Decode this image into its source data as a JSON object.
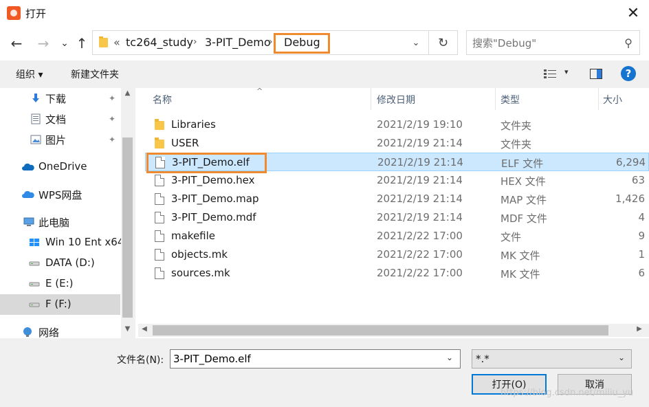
{
  "window": {
    "title": "打开",
    "close_glyph": "✕"
  },
  "nav": {
    "back_glyph": "←",
    "forward_glyph": "→",
    "recent_glyph": "⌄",
    "up_glyph": "↑",
    "breadcrumb_prefix": "«",
    "breadcrumbs": [
      "tc264_study",
      "3-PIT_Demo",
      "Debug"
    ],
    "refresh_glyph": "↻",
    "dropdown_glyph": "⌄"
  },
  "search": {
    "placeholder": "搜索\"Debug\"",
    "icon_glyph": "⚲"
  },
  "toolbar": {
    "organize_label": "组织 ▾",
    "new_folder_label": "新建文件夹",
    "view_dropdown_glyph": "▾",
    "help_glyph": "?"
  },
  "sidebar": {
    "items": [
      {
        "label": "下载",
        "icon": "download-icon",
        "pinned": true
      },
      {
        "label": "文档",
        "icon": "document-icon",
        "pinned": true
      },
      {
        "label": "图片",
        "icon": "picture-icon",
        "pinned": true
      },
      {
        "label": "OneDrive",
        "icon": "cloud-icon",
        "pinned": false
      },
      {
        "label": "WPS网盘",
        "icon": "wps-cloud-icon",
        "pinned": false
      },
      {
        "label": "此电脑",
        "icon": "computer-icon",
        "pinned": false
      },
      {
        "label": "Win 10 Ent x64",
        "icon": "windows-drive-icon",
        "pinned": false
      },
      {
        "label": "DATA (D:)",
        "icon": "drive-icon",
        "pinned": false
      },
      {
        "label": "E (E:)",
        "icon": "drive-icon",
        "pinned": false
      },
      {
        "label": "F (F:)",
        "icon": "drive-icon",
        "pinned": false,
        "selected": true
      },
      {
        "label": "网络",
        "icon": "network-icon",
        "pinned": false
      }
    ],
    "pin_glyph": "📌",
    "scroll_up_glyph": "▲",
    "scroll_down_glyph": "▼"
  },
  "file_list": {
    "columns": {
      "name": "名称",
      "date": "修改日期",
      "type": "类型",
      "size": "大小"
    },
    "sort_glyph": "^",
    "rows": [
      {
        "name": "Libraries",
        "date": "2021/2/19 19:10",
        "type": "文件夹",
        "size": "",
        "kind": "folder"
      },
      {
        "name": "USER",
        "date": "2021/2/19 21:14",
        "type": "文件夹",
        "size": "",
        "kind": "folder"
      },
      {
        "name": "3-PIT_Demo.elf",
        "date": "2021/2/19 21:14",
        "type": "ELF 文件",
        "size": "6,294",
        "kind": "file",
        "selected": true
      },
      {
        "name": "3-PIT_Demo.hex",
        "date": "2021/2/19 21:14",
        "type": "HEX 文件",
        "size": "63",
        "kind": "file"
      },
      {
        "name": "3-PIT_Demo.map",
        "date": "2021/2/19 21:14",
        "type": "MAP 文件",
        "size": "1,426",
        "kind": "file"
      },
      {
        "name": "3-PIT_Demo.mdf",
        "date": "2021/2/19 21:14",
        "type": "MDF 文件",
        "size": "4",
        "kind": "file"
      },
      {
        "name": "makefile",
        "date": "2021/2/22 17:00",
        "type": "文件",
        "size": "9",
        "kind": "file"
      },
      {
        "name": "objects.mk",
        "date": "2021/2/22 17:00",
        "type": "MK 文件",
        "size": "1",
        "kind": "file"
      },
      {
        "name": "sources.mk",
        "date": "2021/2/22 17:00",
        "type": "MK 文件",
        "size": "6",
        "kind": "file"
      }
    ],
    "scroll_left_glyph": "◀",
    "scroll_right_glyph": "▶"
  },
  "bottom": {
    "filename_label": "文件名(N):",
    "filename_value": "3-PIT_Demo.elf",
    "filter_value": "*.*",
    "dropdown_glyph": "⌄",
    "open_label": "打开(O)",
    "cancel_label": "取消",
    "watermark": "https://blog.csdn.net/miliu_yu"
  },
  "colors": {
    "highlight_orange": "#f08a2f",
    "selection_blue": "#cce8ff",
    "accent_blue": "#0078d7"
  }
}
